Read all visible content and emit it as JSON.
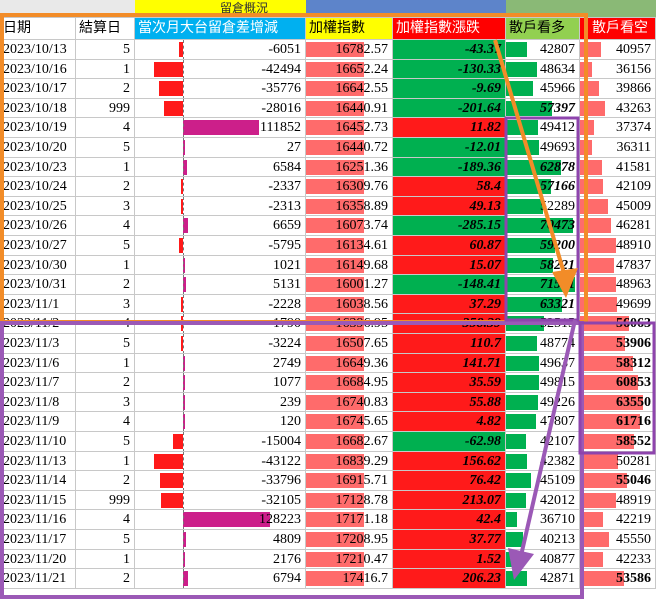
{
  "header_group": {
    "label": "留倉概況"
  },
  "columns": [
    "日期",
    "結算日",
    "當次月大台留倉差增減",
    "加權指數",
    "加權指數漲跌",
    "散戶看多",
    "散戶看空"
  ],
  "colors": {
    "red": "#ff1a1a",
    "green": "#00b050",
    "bar_pink": "#ff6b6b",
    "bar_magenta": "#cc1f8a",
    "header_yellow": "#ffff00",
    "header_cyan": "#00b0f0",
    "header_red": "#ff0000",
    "header_green": "#92d050",
    "highlight_orange": "#f28c28",
    "highlight_purple": "#9b59b6"
  },
  "rows": [
    {
      "date": "2023/10/13",
      "settle": "5",
      "diff": "-6051",
      "index": "16782.57",
      "change": "-43.37",
      "bull": "42807",
      "bear": "40957"
    },
    {
      "date": "2023/10/16",
      "settle": "1",
      "diff": "-42494",
      "index": "16652.24",
      "change": "-130.33",
      "bull": "48634",
      "bear": "36156"
    },
    {
      "date": "2023/10/17",
      "settle": "2",
      "diff": "-35776",
      "index": "16642.55",
      "change": "-9.69",
      "bull": "45966",
      "bear": "39866"
    },
    {
      "date": "2023/10/18",
      "settle": "999",
      "diff": "-28016",
      "index": "16440.91",
      "change": "-201.64",
      "bull": "57397",
      "bear": "43263"
    },
    {
      "date": "2023/10/19",
      "settle": "4",
      "diff": "111852",
      "index": "16452.73",
      "change": "11.82",
      "bull": "49412",
      "bear": "37374"
    },
    {
      "date": "2023/10/20",
      "settle": "5",
      "diff": "27",
      "index": "16440.72",
      "change": "-12.01",
      "bull": "49693",
      "bear": "36311"
    },
    {
      "date": "2023/10/23",
      "settle": "1",
      "diff": "6584",
      "index": "16251.36",
      "change": "-189.36",
      "bull": "62878",
      "bear": "41581"
    },
    {
      "date": "2023/10/24",
      "settle": "2",
      "diff": "-2337",
      "index": "16309.76",
      "change": "58.4",
      "bull": "57166",
      "bear": "42109"
    },
    {
      "date": "2023/10/25",
      "settle": "3",
      "diff": "-2313",
      "index": "16358.89",
      "change": "49.13",
      "bull": "52289",
      "bear": "45009"
    },
    {
      "date": "2023/10/26",
      "settle": "4",
      "diff": "6659",
      "index": "16073.74",
      "change": "-285.15",
      "bull": "70473",
      "bear": "46281"
    },
    {
      "date": "2023/10/27",
      "settle": "5",
      "diff": "-5795",
      "index": "16134.61",
      "change": "60.87",
      "bull": "59200",
      "bear": "48910"
    },
    {
      "date": "2023/10/30",
      "settle": "1",
      "diff": "1021",
      "index": "16149.68",
      "change": "15.07",
      "bull": "58221",
      "bear": "47837"
    },
    {
      "date": "2023/10/31",
      "settle": "2",
      "diff": "5131",
      "index": "16001.27",
      "change": "-148.41",
      "bull": "71541",
      "bear": "48963"
    },
    {
      "date": "2023/11/1",
      "settle": "3",
      "diff": "-2228",
      "index": "16038.56",
      "change": "37.29",
      "bull": "63321",
      "bear": "49699"
    },
    {
      "date": "2023/11/2",
      "settle": "4",
      "diff": "-1790",
      "index": "16396.95",
      "change": "358.39",
      "bull": "52515",
      "bear": "56063"
    },
    {
      "date": "2023/11/3",
      "settle": "5",
      "diff": "-3224",
      "index": "16507.65",
      "change": "110.7",
      "bull": "48774",
      "bear": "53906"
    },
    {
      "date": "2023/11/6",
      "settle": "1",
      "diff": "2749",
      "index": "16649.36",
      "change": "141.71",
      "bull": "49637",
      "bear": "58312"
    },
    {
      "date": "2023/11/7",
      "settle": "2",
      "diff": "1077",
      "index": "16684.95",
      "change": "35.59",
      "bull": "49815",
      "bear": "60853"
    },
    {
      "date": "2023/11/8",
      "settle": "3",
      "diff": "239",
      "index": "16740.83",
      "change": "55.88",
      "bull": "49226",
      "bear": "63550"
    },
    {
      "date": "2023/11/9",
      "settle": "4",
      "diff": "120",
      "index": "16745.65",
      "change": "4.82",
      "bull": "47807",
      "bear": "61716"
    },
    {
      "date": "2023/11/10",
      "settle": "5",
      "diff": "-15004",
      "index": "16682.67",
      "change": "-62.98",
      "bull": "42107",
      "bear": "58552"
    },
    {
      "date": "2023/11/13",
      "settle": "1",
      "diff": "-43122",
      "index": "16839.29",
      "change": "156.62",
      "bull": "42382",
      "bear": "50281"
    },
    {
      "date": "2023/11/14",
      "settle": "2",
      "diff": "-33796",
      "index": "16915.71",
      "change": "76.42",
      "bull": "45109",
      "bear": "55046"
    },
    {
      "date": "2023/11/15",
      "settle": "999",
      "diff": "-32105",
      "index": "17128.78",
      "change": "213.07",
      "bull": "42012",
      "bear": "48919"
    },
    {
      "date": "2023/11/16",
      "settle": "4",
      "diff": "128223",
      "index": "17171.18",
      "change": "42.4",
      "bull": "36710",
      "bear": "42219"
    },
    {
      "date": "2023/11/17",
      "settle": "5",
      "diff": "4809",
      "index": "17208.95",
      "change": "37.77",
      "bull": "40213",
      "bear": "45550"
    },
    {
      "date": "2023/11/20",
      "settle": "1",
      "diff": "2176",
      "index": "17210.47",
      "change": "1.52",
      "bull": "40877",
      "bear": "42233"
    },
    {
      "date": "2023/11/21",
      "settle": "2",
      "diff": "6794",
      "index": "17416.7",
      "change": "206.23",
      "bull": "42871",
      "bear": "53586"
    }
  ]
}
